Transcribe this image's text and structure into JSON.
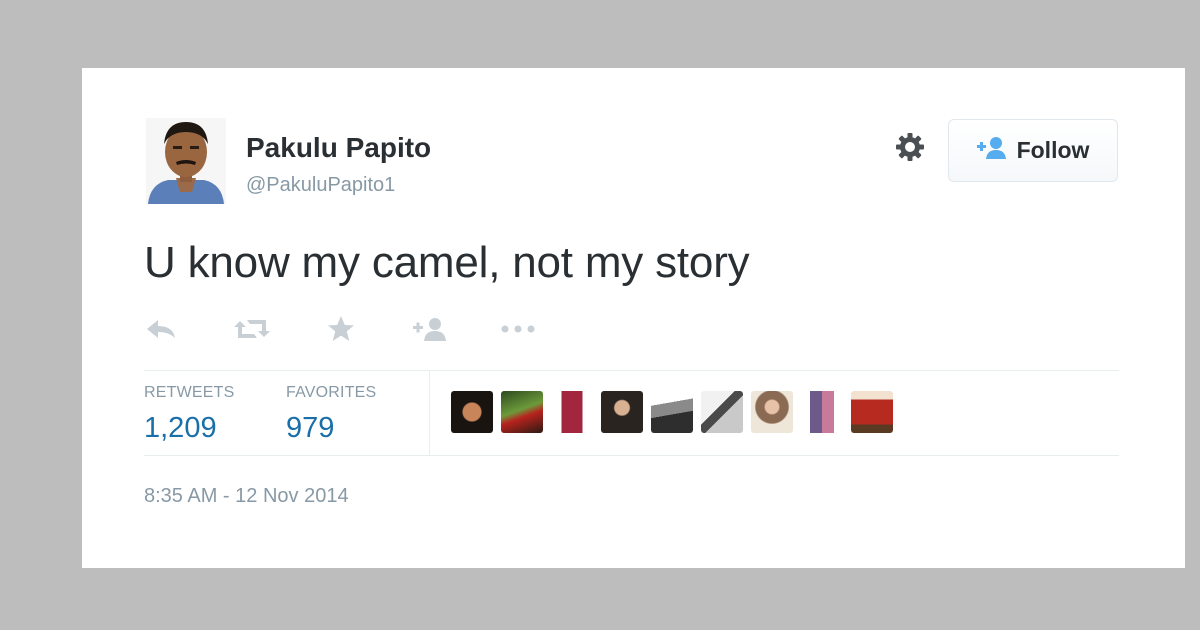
{
  "tweet": {
    "author": {
      "name": "Pakulu Papito",
      "handle": "@PakuluPapito1"
    },
    "follow_label": "Follow",
    "text": "U know my camel, not my story",
    "stats": {
      "retweets_label": "RETWEETS",
      "retweets_count": "1,209",
      "favorites_label": "FAVORITES",
      "favorites_count": "979"
    },
    "timestamp": "8:35 AM - 12 Nov 2014",
    "actions": [
      "reply-icon",
      "retweet-icon",
      "favorite-icon",
      "follow-icon",
      "more-icon"
    ]
  },
  "colors": {
    "background": "#bdbdbd",
    "card": "#ffffff",
    "text": "#292f33",
    "muted": "#8899a6",
    "stat_number": "#1b6fa8",
    "follow_icon": "#55acee"
  }
}
